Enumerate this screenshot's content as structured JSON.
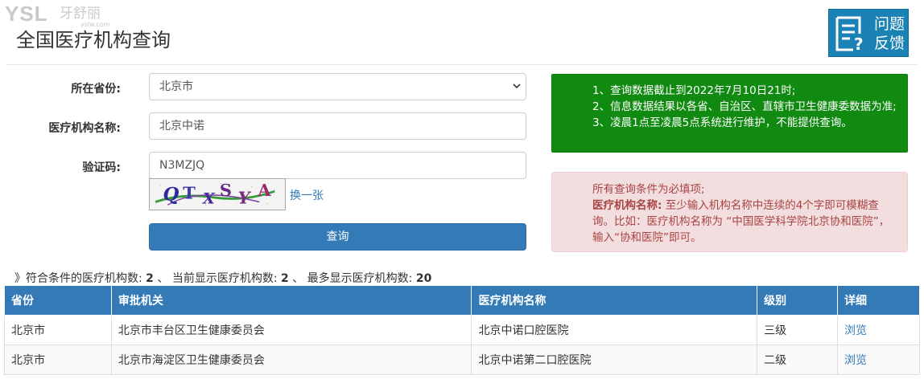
{
  "watermark": {
    "brand": "YSL",
    "name": "牙舒丽",
    "url": "yslw.com"
  },
  "page_title": "全国医疗机构查询",
  "feedback_button": {
    "label_line1": "问题",
    "label_line2": "反馈"
  },
  "form": {
    "province_label": "所在省份:",
    "province_value": "北京市",
    "name_label": "医疗机构名称:",
    "name_value": "北京中诺",
    "captcha_label": "验证码:",
    "captcha_value": "N3MZJQ",
    "captcha_image_text": "QTXSYA",
    "captcha_refresh": "换一张",
    "submit_label": "查询"
  },
  "notice_green": {
    "line1": "1、查询数据截止到2022年7月10日21时;",
    "line2": "2、信息数据结果以各省、自治区、直辖市卫生健康委数据为准;",
    "line3": "3、凌晨1点至凌晨5点系统进行维护，不能提供查询。"
  },
  "notice_red": {
    "line1": "所有查询条件为必填项;",
    "bold": "医疗机构名称:",
    "rest": " 至少输入机构名称中连续的4个字即可模糊查询。比如：医疗机构名称为 “中国医学科学院北京协和医院”，输入“协和医院”即可。"
  },
  "summary": {
    "prefix": "》符合条件的医疗机构数:",
    "matched": "2",
    "sep1": "、  当前显示医疗机构数:",
    "shown": "2",
    "sep2": "、  最多显示医疗机构数:",
    "max": "20"
  },
  "table": {
    "headers": [
      "省份",
      "审批机关",
      "医疗机构名称",
      "级别",
      "详细"
    ],
    "rows": [
      [
        "北京市",
        "北京市丰台区卫生健康委员会",
        "北京中诺口腔医院",
        "三级",
        "浏览"
      ],
      [
        "北京市",
        "北京市海淀区卫生健康委员会",
        "北京中诺第二口腔医院",
        "二级",
        "浏览"
      ]
    ]
  },
  "colors": {
    "primary": "#337ab7",
    "green_notice": "#118a11",
    "red_notice_bg": "#f2dede",
    "red_notice_text": "#a94442",
    "feedback_bg": "#1a82b5"
  },
  "icons": [
    "feedback-document-icon",
    "chevron-down-icon"
  ]
}
